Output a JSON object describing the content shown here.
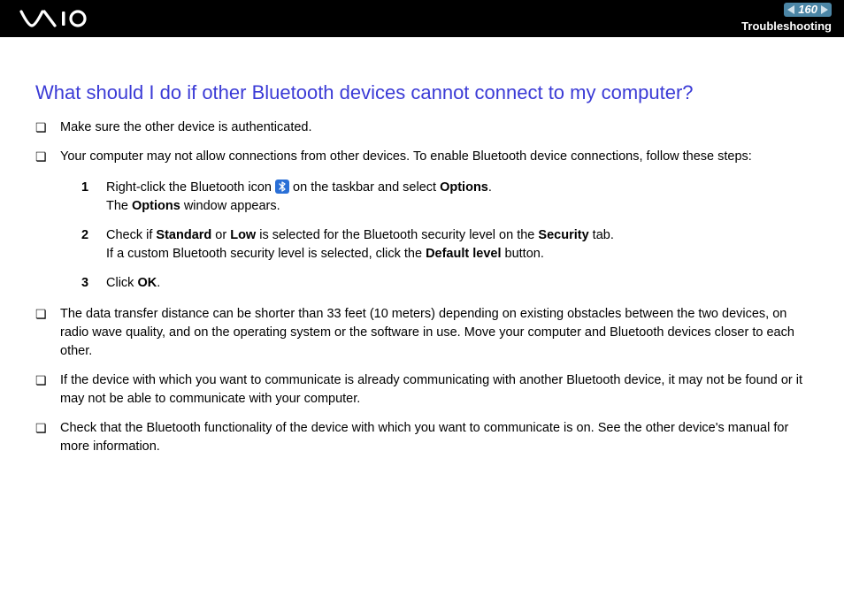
{
  "header": {
    "page_number": "160",
    "section": "Troubleshooting"
  },
  "title": "What should I do if other Bluetooth devices cannot connect to my computer?",
  "bullets": {
    "b1": "Make sure the other device is authenticated.",
    "b2": "Your computer may not allow connections from other devices. To enable Bluetooth device connections, follow these steps:",
    "b3": "The data transfer distance can be shorter than 33 feet (10 meters) depending on existing obstacles between the two devices, on radio wave quality, and on the operating system or the software in use. Move your computer and Bluetooth devices closer to each other.",
    "b4": "If the device with which you want to communicate is already communicating with another Bluetooth device, it may not be found or it may not be able to communicate with your computer.",
    "b5": "Check that the Bluetooth functionality of the device with which you want to communicate is on. See the other device's manual for more information."
  },
  "steps": {
    "n1": "1",
    "s1_a": "Right-click the Bluetooth icon ",
    "s1_b": " on the taskbar and select ",
    "s1_options": "Options",
    "s1_c": ".",
    "s1_d": "The ",
    "s1_options2": "Options",
    "s1_e": " window appears.",
    "n2": "2",
    "s2_a": "Check if ",
    "s2_standard": "Standard",
    "s2_b": " or ",
    "s2_low": "Low",
    "s2_c": " is selected for the Bluetooth security level on the ",
    "s2_security": "Security",
    "s2_d": " tab.",
    "s2_e": "If a custom Bluetooth security level is selected, click the ",
    "s2_default": "Default level",
    "s2_f": " button.",
    "n3": "3",
    "s3_a": "Click ",
    "s3_ok": "OK",
    "s3_b": "."
  }
}
